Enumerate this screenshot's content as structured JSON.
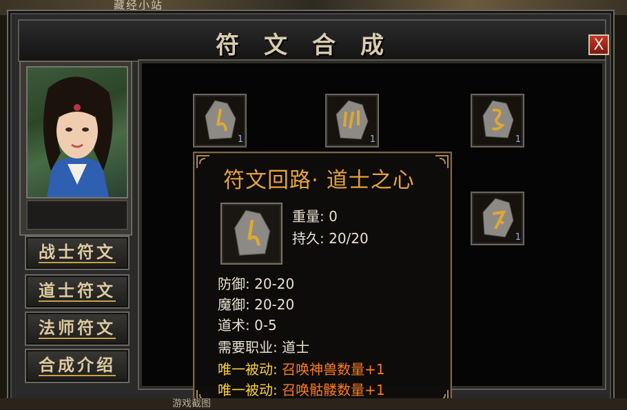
{
  "background": {
    "top_caption": "藏经小站",
    "bottom_caption": "游戏截图"
  },
  "window": {
    "title": "符文合成",
    "close_label": "X"
  },
  "sidebar": {
    "buttons": [
      {
        "label": "战士符文"
      },
      {
        "label": "道士符文"
      },
      {
        "label": "法师符文"
      },
      {
        "label": "合成介绍"
      }
    ]
  },
  "rune_slots": [
    {
      "count": "1",
      "glyph": "rune-a-icon"
    },
    {
      "count": "1",
      "glyph": "rune-b-icon"
    },
    {
      "count": "1",
      "glyph": "rune-c-icon"
    },
    {
      "count": "1",
      "glyph": "rune-d-icon"
    }
  ],
  "tooltip": {
    "title": "符文回路· 道士之心",
    "weight_label": "重量:",
    "weight_value": "0",
    "durability_label": "持久:",
    "durability_value": "20/20",
    "stats": [
      {
        "label": "防御:",
        "value": "20-20"
      },
      {
        "label": "魔御:",
        "value": "20-20"
      },
      {
        "label": "道术:",
        "value": "0-5"
      },
      {
        "label": "需要职业:",
        "value": "道士"
      }
    ],
    "passives": [
      {
        "label": "唯一被动:",
        "value": "召唤神兽数量+1"
      },
      {
        "label": "唯一被动:",
        "value": "召唤骷髅数量+1"
      }
    ]
  },
  "colors": {
    "accent_gold": "#e8a23a",
    "passive_yellow": "#ffd23a",
    "passive_orange": "#ff7a1f"
  }
}
